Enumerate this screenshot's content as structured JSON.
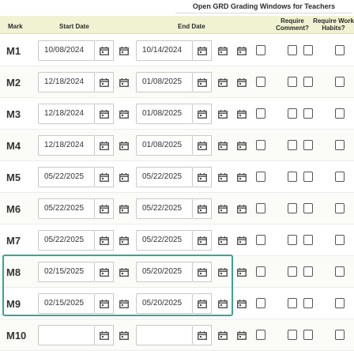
{
  "banner": {
    "title": "Open GRD Grading Windows for Teachers"
  },
  "columns": {
    "mark": "Mark",
    "start_date": "Start Date",
    "end_date": "End Date",
    "require_comment_1": "Require",
    "require_comment_2": "Comment?",
    "require_habits_1": "Require Work",
    "require_habits_2": "Habits?"
  },
  "rows": [
    {
      "mark": "M1",
      "start": "10/08/2024",
      "end": "10/14/2024"
    },
    {
      "mark": "M2",
      "start": "12/18/2024",
      "end": "01/08/2025"
    },
    {
      "mark": "M3",
      "start": "12/18/2024",
      "end": "01/08/2025"
    },
    {
      "mark": "M4",
      "start": "12/18/2024",
      "end": "01/08/2025"
    },
    {
      "mark": "M5",
      "start": "05/22/2025",
      "end": "05/22/2025"
    },
    {
      "mark": "M6",
      "start": "05/22/2025",
      "end": "05/22/2025"
    },
    {
      "mark": "M7",
      "start": "05/22/2025",
      "end": "05/22/2025"
    },
    {
      "mark": "M8",
      "start": "02/15/2025",
      "end": "05/20/2025"
    },
    {
      "mark": "M9",
      "start": "02/15/2025",
      "end": "05/20/2025"
    },
    {
      "mark": "M10",
      "start": "",
      "end": ""
    }
  ],
  "icons": {
    "calendar": "calendar-icon",
    "checkbox": "checkbox-unchecked"
  },
  "colors": {
    "header_bg": "#f0f2d2",
    "highlight": "#3aa497"
  }
}
